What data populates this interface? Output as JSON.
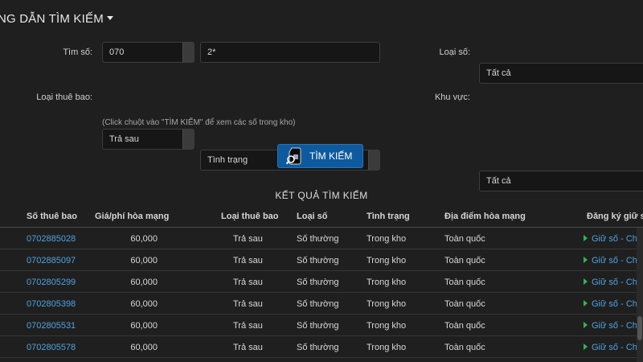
{
  "header": {
    "title": "NG DẪN TÌM KIẾM"
  },
  "form": {
    "tim_so_label": "Tìm số:",
    "tim_so_prefix": "070",
    "tim_so_pattern": "2*",
    "loai_so_label": "Loại số:",
    "loai_so_value": "Tất cả",
    "loai_thue_bao_label": "Loại thuê bao:",
    "loai_thue_bao_value": "Trả sau",
    "tinh_trang_value": "Tình trạng",
    "khu_vuc_label": "Khu vực:",
    "khu_vuc_value": "Tất cả",
    "hint": "(Click chuột vào \"TÌM KIẾM\" để xem các số trong kho)",
    "search_button_label": "TÌM KIẾM"
  },
  "results": {
    "title": "KẾT QUẢ TÌM KIẾM",
    "columns": [
      "Số thuê bao",
      "Giá/phí hòa mạng",
      "Loại thuê bao",
      "Loại số",
      "Tình trạng",
      "Địa điểm hòa mạng",
      "Đăng ký giữ số"
    ],
    "action_label": "Giữ số - Chi tiết",
    "rows": [
      [
        "0702885028",
        "60,000",
        "Trả sau",
        "Số thường",
        "Trong kho",
        "Toàn quốc"
      ],
      [
        "0702885097",
        "60,000",
        "Trả sau",
        "Số thường",
        "Trong kho",
        "Toàn quốc"
      ],
      [
        "0702805299",
        "60,000",
        "Trả sau",
        "Số thường",
        "Trong kho",
        "Toàn quốc"
      ],
      [
        "0702805398",
        "60,000",
        "Trả sau",
        "Số thường",
        "Trong kho",
        "Toàn quốc"
      ],
      [
        "0702805531",
        "60,000",
        "Trả sau",
        "Số thường",
        "Trong kho",
        "Toàn quốc"
      ],
      [
        "0702805578",
        "60,000",
        "Trả sau",
        "Số thường",
        "Trong kho",
        "Toàn quốc"
      ]
    ]
  },
  "colors": {
    "background": "#1f1f1f",
    "link": "#4fa3e0",
    "button": "#0e5a9e",
    "arrow": "#2fb84a"
  },
  "icons": {
    "title_caret": "caret-down-icon",
    "search_button": "sim-search-icon",
    "row_action": "triangle-right-icon"
  }
}
